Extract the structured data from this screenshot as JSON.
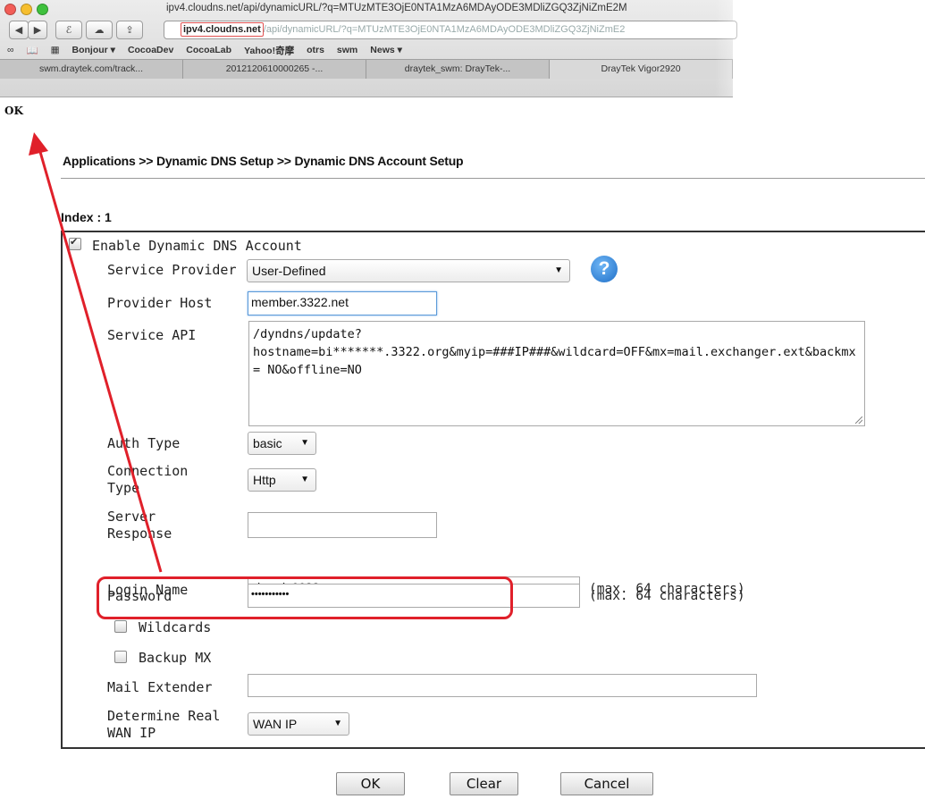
{
  "browser": {
    "window_title": "ipv4.cloudns.net/api/dynamicURL/?q=MTUzMTE3OjE0NTA1MzA6MDAyODE3MDliZGQ3ZjNiZmE2M",
    "url_host": "ipv4.cloudns.net",
    "url_rest": "/api/dynamicURL/?q=MTUzMTE3OjE0NTA1MzA6MDAyODE3MDliZGQ3ZjNiZmE2",
    "favorites": [
      "Bonjour ▾",
      "CocoaDev",
      "CocoaLab",
      "Yahoo!奇摩",
      "otrs",
      "swm",
      "News ▾"
    ],
    "tabs": [
      "swm.draytek.com/track...",
      "2012120610000265 -...",
      "draytek_swm: DrayTek-...",
      "DrayTek Vigor2920"
    ],
    "page_response": "OK"
  },
  "page": {
    "breadcrumb": "Applications >> Dynamic DNS Setup >> Dynamic DNS Account Setup",
    "index_label": "Index : 1"
  },
  "form": {
    "enable_label": "Enable Dynamic DNS Account",
    "enable_checked": true,
    "service_provider_label": "Service Provider",
    "service_provider_value": "User-Defined",
    "provider_host_label": "Provider Host",
    "provider_host_value": "member.3322.net",
    "service_api_label": "Service API",
    "service_api_value": "/dyndns/update?\nhostname=bi*******.3322.org&myip=###IP###&wildcard=OFF&mx=mail.exchanger.ext&backmx= NO&offline=NO",
    "auth_type_label": "Auth Type",
    "auth_type_value": "basic",
    "connection_type_label": "Connection Type",
    "connection_type_value": "Http",
    "server_response_label": "Server Response",
    "server_response_value": "",
    "login_name_label": "Login Name",
    "login_name_value": "chronic6633",
    "password_label": "Password",
    "password_value": "•••••••••••",
    "max_hint": "(max. 64 characters)",
    "wildcards_label": "Wildcards",
    "backup_mx_label": "Backup MX",
    "mail_extender_label": "Mail Extender",
    "mail_extender_value": "",
    "determine_wan_label": "Determine Real WAN IP",
    "determine_wan_value": "WAN IP"
  },
  "buttons": {
    "ok": "OK",
    "clear": "Clear",
    "cancel": "Cancel"
  },
  "colors": {
    "annotation_red": "#e0202a",
    "help_blue": "#1f6fc8"
  }
}
